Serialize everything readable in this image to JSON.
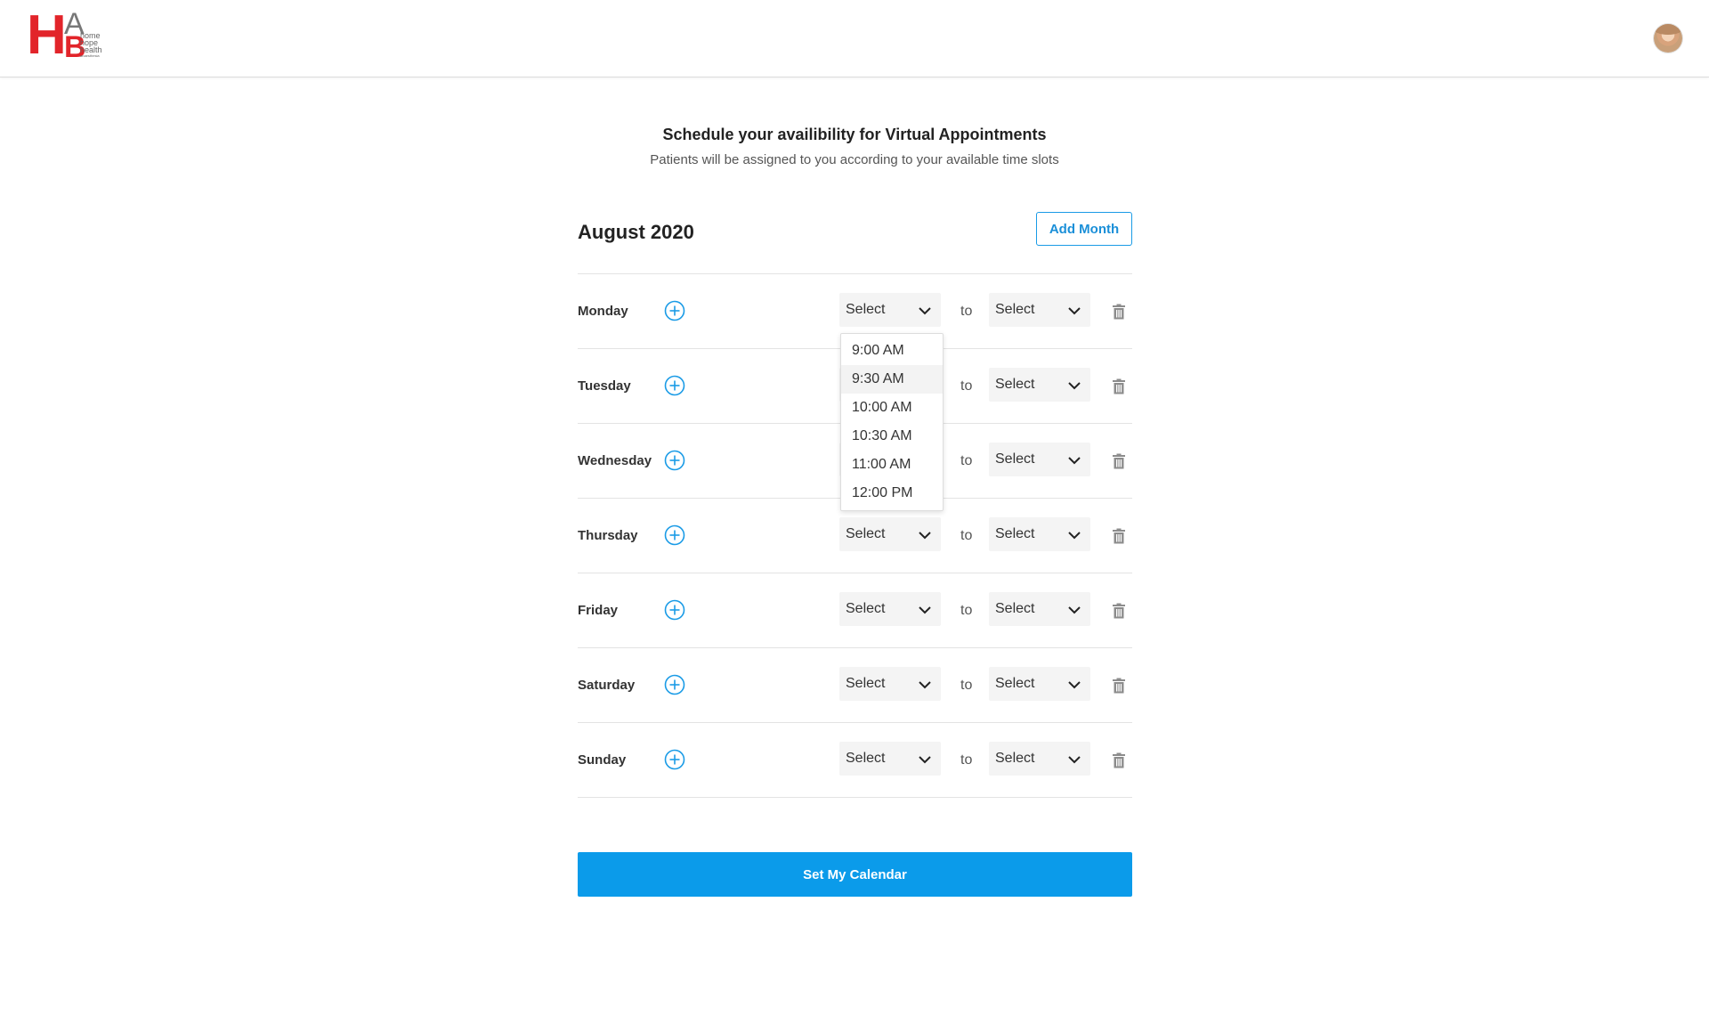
{
  "header": {
    "logo": {
      "letters": [
        "H",
        "A",
        "B"
      ],
      "words": [
        "home",
        "hope",
        "health"
      ],
      "tagline": "anaesthesia"
    },
    "avatar_icon": "user-avatar"
  },
  "intro": {
    "title": "Schedule your availibility for Virtual Appointments",
    "subtitle": "Patients will be assigned to you according to your available time slots"
  },
  "calendar": {
    "month": "August 2020",
    "add_month_label": "Add Month",
    "separator": "to",
    "select_placeholder": "Select",
    "days": [
      {
        "label": "Monday"
      },
      {
        "label": "Tuesday"
      },
      {
        "label": "Wednesday"
      },
      {
        "label": "Thursday"
      },
      {
        "label": "Friday"
      },
      {
        "label": "Saturday"
      },
      {
        "label": "Sunday"
      }
    ],
    "open_dropdown": {
      "row": "Monday",
      "options": [
        "9:00 AM",
        "9:30 AM",
        "10:00 AM",
        "10:30 AM",
        "11:00 AM",
        "12:00 PM"
      ],
      "highlighted": "9:30 AM"
    }
  },
  "submit_label": "Set My Calendar",
  "colors": {
    "accent": "#0b9bea",
    "brand_red": "#e2242a",
    "select_bg": "#f4f4f4"
  }
}
